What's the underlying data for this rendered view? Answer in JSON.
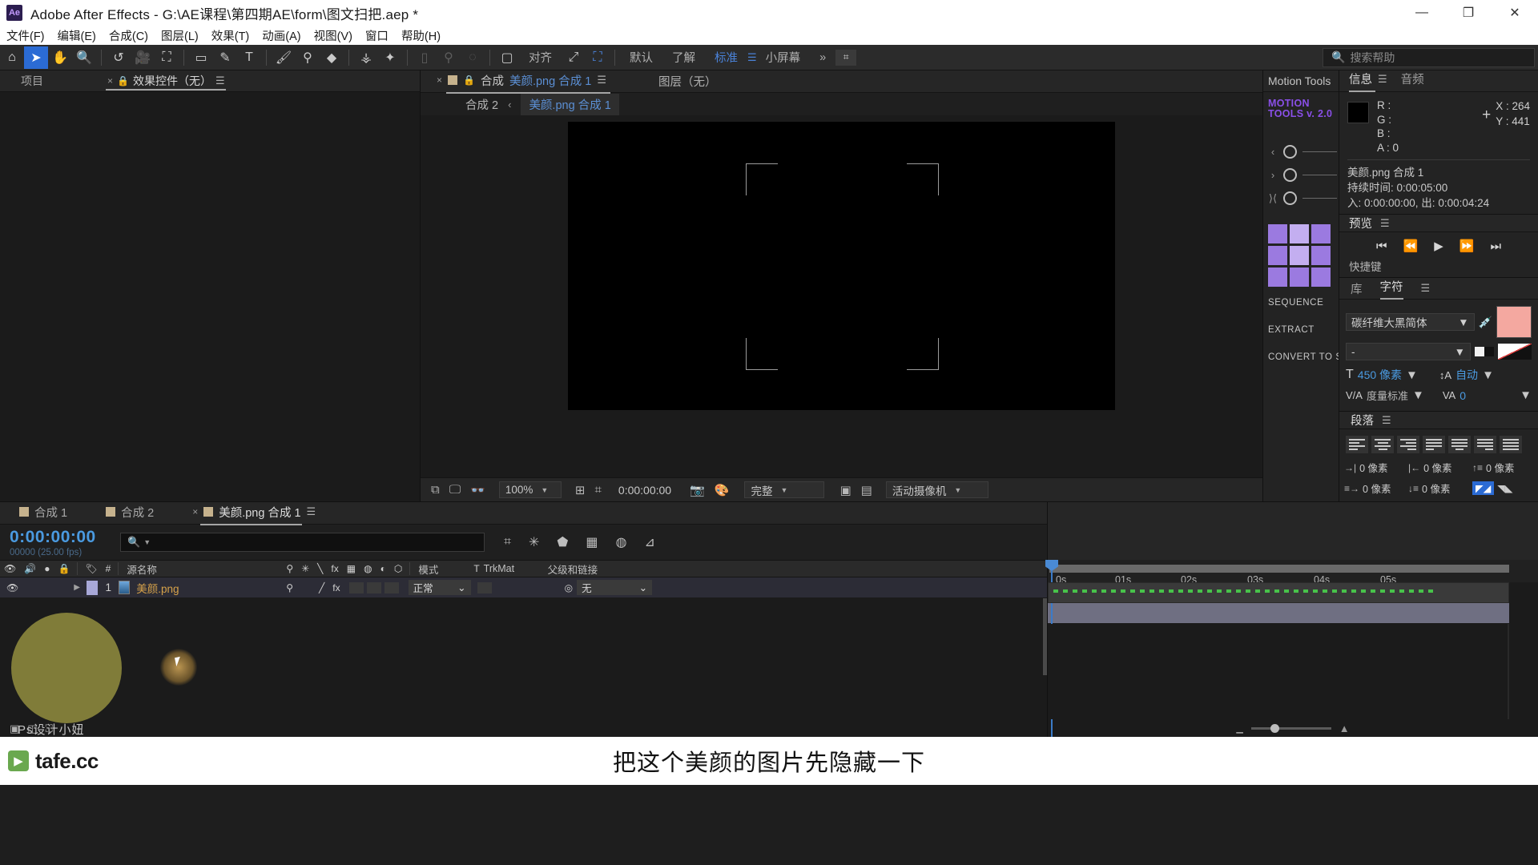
{
  "titlebar": {
    "app_badge": "Ae",
    "title": "Adobe After Effects - G:\\AE课程\\第四期AE\\form\\图文扫把.aep *",
    "minimize": "—",
    "maximize": "❐",
    "close": "✕"
  },
  "menubar": {
    "items": [
      {
        "label": "文件(F)"
      },
      {
        "label": "编辑(E)"
      },
      {
        "label": "合成(C)"
      },
      {
        "label": "图层(L)"
      },
      {
        "label": "效果(T)"
      },
      {
        "label": "动画(A)"
      },
      {
        "label": "视图(V)"
      },
      {
        "label": "窗口"
      },
      {
        "label": "帮助(H)"
      }
    ]
  },
  "toolbar": {
    "align_label": "对齐",
    "workspace_default": "默认",
    "workspace_learn": "了解",
    "workspace_standard": "标准",
    "workspace_small": "小屏幕",
    "overflow": "»",
    "search_placeholder": "搜索帮助"
  },
  "project_panel": {
    "tabs": [
      {
        "label": "项目",
        "selected": false
      },
      {
        "label": "效果控件（无）",
        "selected": true
      }
    ]
  },
  "composition_panel": {
    "tab_prefix": "合成",
    "tab_name": "美颜.png 合成 1",
    "layer_tab": "图层（无）",
    "breadcrumb_parent": "合成 2",
    "breadcrumb_current": "美颜.png 合成 1",
    "toolbar": {
      "zoom": "100%",
      "timecode": "0:00:00:00",
      "quality": "完整",
      "camera": "活动摄像机"
    }
  },
  "motion_tools": {
    "panel_title": "Motion Tools",
    "logo_line1": "MOTION",
    "logo_line2": "TOOLS v. 2.0",
    "buttons": [
      "SEQUENCE",
      "EXTRACT",
      "CONVERT TO SHAPE"
    ]
  },
  "info_panel": {
    "tabs": [
      {
        "label": "信息",
        "selected": true
      },
      {
        "label": "音频",
        "selected": false
      }
    ],
    "channels": [
      "R :",
      "G :",
      "B :",
      "A : 0"
    ],
    "coord_x": "X : 264",
    "coord_y": "Y : 441",
    "item_name": "美颜.png 合成 1",
    "duration": "持续时间: 0:00:05:00",
    "in_out": "入: 0:00:00:00,  出: 0:00:04:24"
  },
  "preview_panel": {
    "title": "预览",
    "sub": "快捷键",
    "transport": [
      "⏮",
      "⏪",
      "▶",
      "⏩",
      "⏭"
    ]
  },
  "character_panel": {
    "tabs": [
      {
        "label": "库",
        "selected": false
      },
      {
        "label": "字符",
        "selected": true
      }
    ],
    "font_family": "碳纤维大黑简体",
    "font_style": "-",
    "font_size": "450 像素",
    "leading": "自动",
    "tracking_label": "度量标准",
    "tracking_value": "0"
  },
  "paragraph_panel": {
    "title": "段落",
    "indent_values": [
      "0 像素",
      "0 像素",
      "0 像素",
      "0 像素",
      "0 像素",
      "0 像素"
    ]
  },
  "timeline": {
    "tabs": [
      {
        "label": "合成 1",
        "selected": false
      },
      {
        "label": "合成 2",
        "selected": false
      },
      {
        "label": "美颜.png 合成 1",
        "selected": true
      }
    ],
    "current_time": "0:00:00:00",
    "frame_rate": "00000 (25.00 fps)",
    "search_placeholder": "",
    "columns": [
      "#",
      "源名称",
      "模式",
      "TrkMat",
      "父级和链接"
    ],
    "layers": [
      {
        "index": "1",
        "name": "美颜.png",
        "mode": "正常",
        "trkmat": "",
        "parent": "无"
      }
    ],
    "ruler_ticks": [
      "0s",
      "01s",
      "02s",
      "03s",
      "04s",
      "05s"
    ]
  },
  "footer": {
    "brand": "tafe.cc",
    "subtitle": "把这个美颜的图片先隐藏一下"
  },
  "colors": {
    "accent_blue": "#4a9ae0",
    "tab_blue": "#5b8fd4",
    "purple": "#8a4fe8",
    "green_marker": "#47c24a",
    "layer_name": "#d6a24a"
  }
}
